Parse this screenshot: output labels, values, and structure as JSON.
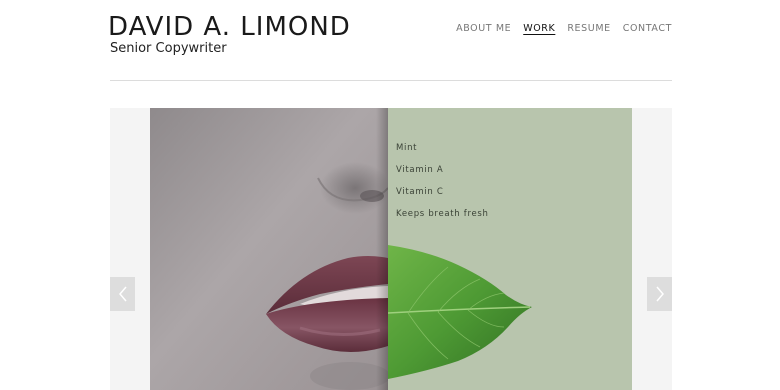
{
  "header": {
    "name": "DAVID A. LIMOND",
    "subtitle": "Senior Copywriter"
  },
  "nav": {
    "items": [
      {
        "label": "ABOUT ME",
        "active": false
      },
      {
        "label": "WORK",
        "active": true
      },
      {
        "label": "RESUME",
        "active": false
      },
      {
        "label": "CONTACT",
        "active": false
      }
    ]
  },
  "slide": {
    "features": [
      "Mint",
      "Vitamin A",
      "Vitamin C",
      "Keeps breath fresh"
    ]
  },
  "icons": {
    "prev": "chevron-left-icon",
    "next": "chevron-right-icon"
  },
  "colors": {
    "panel": "#b8c5ad",
    "leaf": "#4e9a34",
    "lips": "#6e3a48",
    "skin": "#a8a2a4"
  }
}
